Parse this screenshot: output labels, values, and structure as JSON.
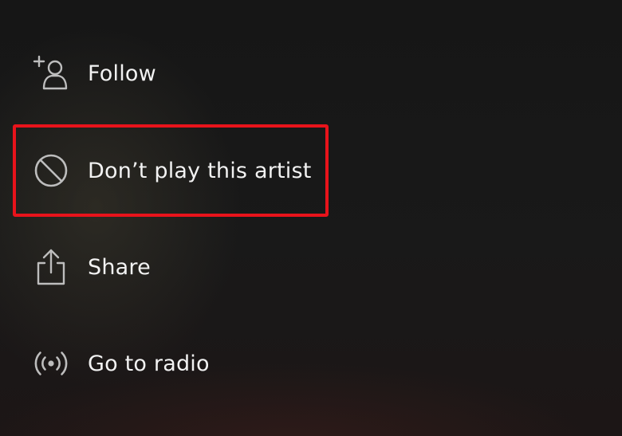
{
  "colors": {
    "icon": "#bdbdbd",
    "text": "#f2f2f2",
    "highlight": "#e8131b"
  },
  "menu": {
    "items": [
      {
        "label": "Follow",
        "icon": "add-user-icon"
      },
      {
        "label": "Don’t play this artist",
        "icon": "block-icon"
      },
      {
        "label": "Share",
        "icon": "share-icon"
      },
      {
        "label": "Go to radio",
        "icon": "radio-icon"
      }
    ]
  }
}
